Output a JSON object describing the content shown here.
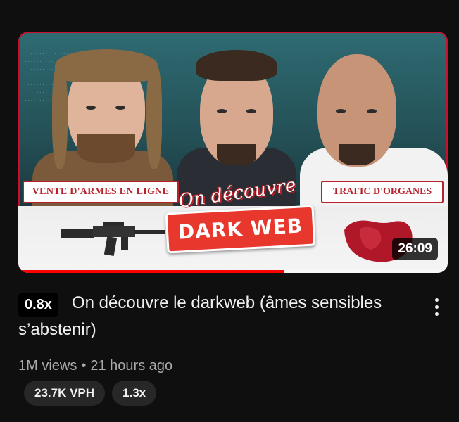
{
  "video": {
    "thumbnail": {
      "tag_left": "VENTE D'ARMES EN LIGNE",
      "script_title": "On découvre le",
      "headline": "DARK WEB",
      "tag_right": "TRAFIC D'ORGANES",
      "duration": "26:09",
      "watch_progress": 0.62,
      "accent_color": "#e8372c",
      "progress_color": "#ff0000"
    },
    "speed": "0.8x",
    "title": "On découvre le darkweb (âmes sensibles s’abstenir)",
    "views": "1M views",
    "separator": "•",
    "age": "21 hours ago",
    "chips": [
      "23.7K VPH",
      "1.3x"
    ],
    "menu_icon": "vertical-ellipsis-icon"
  }
}
